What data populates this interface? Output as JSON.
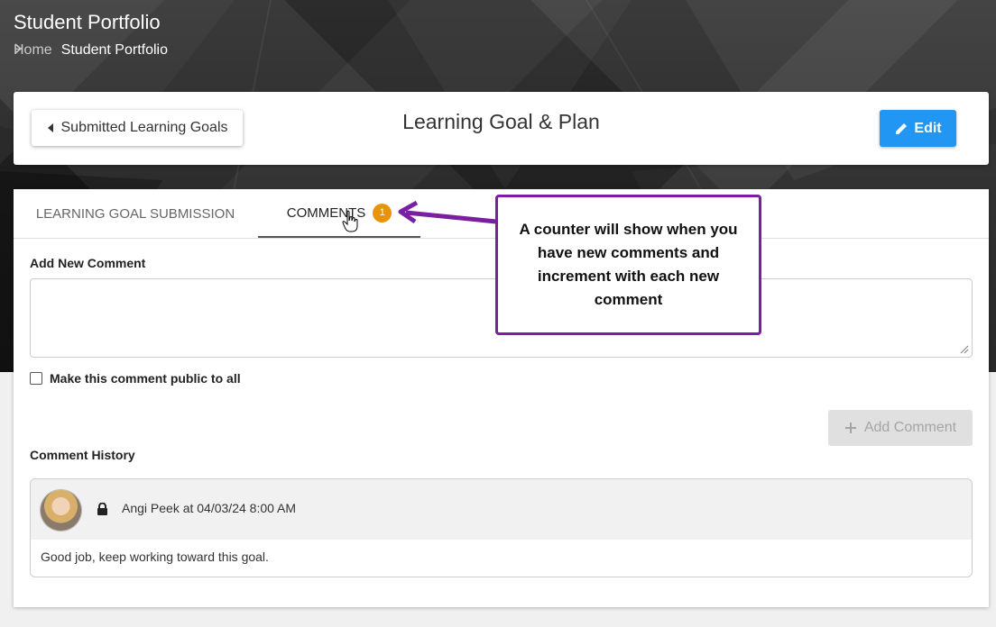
{
  "page": {
    "title": "Student Portfolio",
    "breadcrumb": {
      "home": "Home",
      "current": "Student Portfolio"
    }
  },
  "header": {
    "back_label": "Submitted Learning Goals",
    "title": "Learning Goal & Plan",
    "edit_label": "Edit"
  },
  "tabs": {
    "submission": "LEARNING GOAL SUBMISSION",
    "comments": "COMMENTS",
    "comments_count": "1"
  },
  "form": {
    "add_label": "Add New Comment",
    "comment_value": "",
    "public_label": "Make this comment public to all",
    "public_checked": false,
    "submit_label": "Add Comment"
  },
  "history": {
    "label": "Comment History",
    "items": [
      {
        "author_line": "Angi Peek at 04/03/24 8:00 AM",
        "text": "Good job, keep working toward this goal."
      }
    ]
  },
  "callout": {
    "text": "A counter will show when you have new comments and increment with each new comment"
  },
  "colors": {
    "primary": "#2196f3",
    "badge": "#e6950a",
    "callout_border": "#7b1fa2"
  },
  "icons": [
    "chevron-right-icon",
    "caret-left-icon",
    "pencil-icon",
    "plus-icon",
    "lock-icon",
    "hand-cursor-icon",
    "arrow-icon"
  ]
}
